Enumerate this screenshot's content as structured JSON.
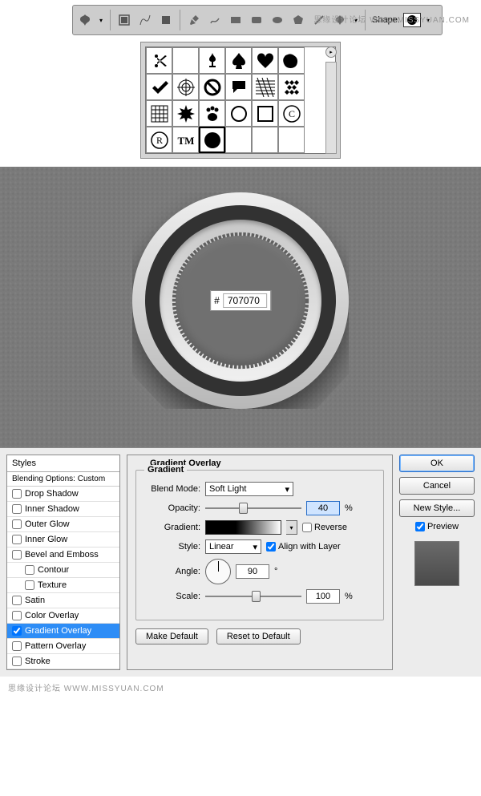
{
  "watermark": {
    "text": "思缘设计论坛  WWW.MISSYUAN.COM"
  },
  "toolbar": {
    "shape_label": "Shape:"
  },
  "shape_picker": {
    "selected_index": 20,
    "icons": [
      "scissors",
      "blank",
      "fleur",
      "spade",
      "heart",
      "blob",
      "check",
      "target",
      "no",
      "speech",
      "hatch",
      "checker",
      "grid",
      "burst",
      "paw",
      "ring",
      "square",
      "copyright",
      "registered",
      "trademark",
      "circle",
      "",
      "",
      ""
    ]
  },
  "knob": {
    "hex_prefix": "#",
    "hex_value": "707070"
  },
  "dialog": {
    "styles_header": "Styles",
    "blending_sub": "Blending Options: Custom",
    "items": [
      {
        "label": "Drop Shadow",
        "checked": false
      },
      {
        "label": "Inner Shadow",
        "checked": false
      },
      {
        "label": "Outer Glow",
        "checked": false
      },
      {
        "label": "Inner Glow",
        "checked": false
      },
      {
        "label": "Bevel and Emboss",
        "checked": false
      },
      {
        "label": "Contour",
        "checked": false,
        "indent": true
      },
      {
        "label": "Texture",
        "checked": false,
        "indent": true
      },
      {
        "label": "Satin",
        "checked": false
      },
      {
        "label": "Color Overlay",
        "checked": false
      },
      {
        "label": "Gradient Overlay",
        "checked": true,
        "active": true
      },
      {
        "label": "Pattern Overlay",
        "checked": false
      },
      {
        "label": "Stroke",
        "checked": false
      }
    ],
    "section_title": "Gradient Overlay",
    "gradient_legend": "Gradient",
    "blend_mode_label": "Blend Mode:",
    "blend_mode_value": "Soft Light",
    "opacity_label": "Opacity:",
    "opacity_value": "40",
    "opacity_unit": "%",
    "gradient_label": "Gradient:",
    "reverse_label": "Reverse",
    "reverse_checked": false,
    "style_label": "Style:",
    "style_value": "Linear",
    "align_label": "Align with Layer",
    "align_checked": true,
    "angle_label": "Angle:",
    "angle_value": "90",
    "angle_unit": "°",
    "scale_label": "Scale:",
    "scale_value": "100",
    "scale_unit": "%",
    "make_default": "Make Default",
    "reset_default": "Reset to Default",
    "ok": "OK",
    "cancel": "Cancel",
    "new_style": "New Style...",
    "preview_label": "Preview",
    "preview_checked": true
  }
}
